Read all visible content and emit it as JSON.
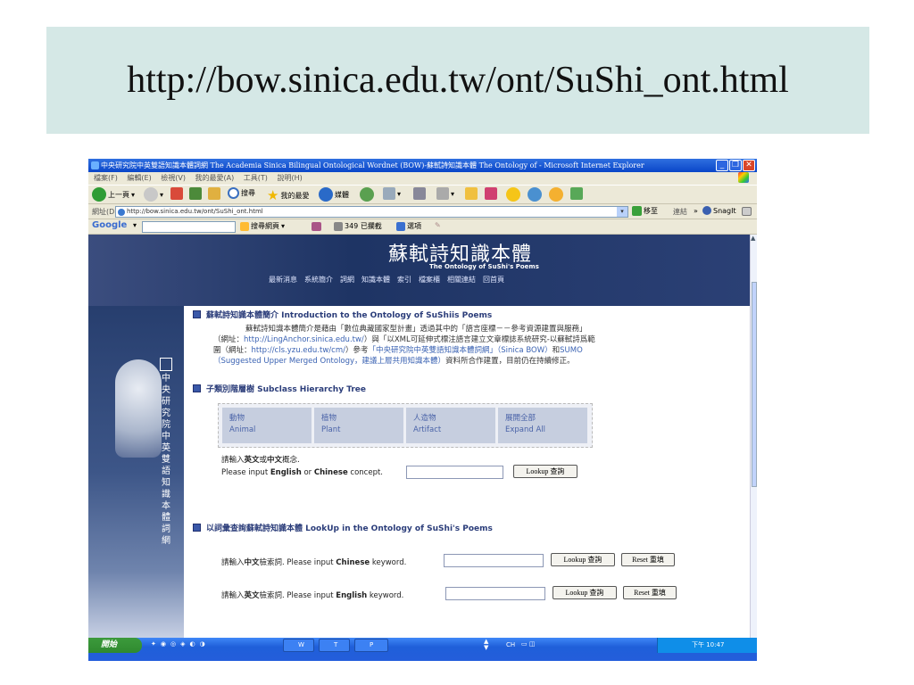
{
  "slide": {
    "title": "http://bow.sinica.edu.tw/ont/SuShi_ont.html"
  },
  "window": {
    "title": "中央研究院中英雙語知識本體詞網 The Academia Sinica Bilingual Ontological Wordnet (BOW)-蘇軾詩知識本體 The Ontology of - Microsoft Internet Explorer",
    "menu": [
      "檔案(F)",
      "編輯(E)",
      "檢視(V)",
      "我的最愛(A)",
      "工具(T)",
      "說明(H)"
    ],
    "toolbar": {
      "back": "上一頁",
      "search": "搜尋",
      "favorites": "我的最愛",
      "media": "媒體"
    },
    "address_label": "網址(D)",
    "address": "http://bow.sinica.edu.tw/ont/SuShi_ont.html",
    "go": "移至",
    "links": "連結",
    "snagit": "SnagIt",
    "google": {
      "logo": "Google",
      "search_web": "搜尋網頁",
      "blocked": "349 已攔截",
      "options": "選項"
    }
  },
  "page": {
    "banner_title": "蘇軾詩知識本體",
    "banner_subtitle": "The Ontology of SuShi's Poems",
    "nav": "最新消息　系統簡介　詞網　知識本體　索引　檔案櫃　相關連結　回首頁",
    "side_text": [
      "中",
      "央",
      "研",
      "究",
      "院",
      "中",
      "英",
      "雙",
      "語",
      "知",
      "識",
      "本",
      "體",
      "詞",
      "網"
    ],
    "intro": {
      "heading": "蘇軾詩知識本體簡介 Introduction to the Ontology of SuShiis Poems",
      "p1": "蘇軾詩知識本體簡介是藉由「數位典藏國家型計畫」透過其中的「語言座標－－參考資源建置與服務」",
      "p2_a": "（網址：",
      "p2_link1": "http://LingAnchor.sinica.edu.tw/",
      "p2_b": "）與「以XML可延伸式標注語言建立文章標誌系統研究-以蘇軾詩爲範",
      "p3_a": "圍（網址：",
      "p3_link": "http://cls.yzu.edu.tw/cm/",
      "p3_b": "）參考",
      "p3_link2": "「中央研究院中英雙語知識本體詞網」（Sinica BOW）",
      "p3_c": "和",
      "p3_link3": "SUMO",
      "p4_link": "（Suggested Upper Merged Ontology，建議上層共用知識本體）",
      "p4_b": "資料所合作建置，目前仍在持續修正。"
    },
    "subclass": {
      "heading": "子類別階層樹 Subclass Hierarchy Tree",
      "items": [
        {
          "zh": "動物",
          "en": "Animal"
        },
        {
          "zh": "植物",
          "en": "Plant"
        },
        {
          "zh": "人造物",
          "en": "Artifact"
        },
        {
          "zh": "展開全部",
          "en": "Expand All"
        }
      ],
      "prompt_zh_a": "請輸入",
      "prompt_zh_b": "英文",
      "prompt_zh_c": "或",
      "prompt_zh_d": "中文",
      "prompt_zh_e": "概念.",
      "prompt_en_a": "Please input ",
      "prompt_en_b": "English",
      "prompt_en_c": " or ",
      "prompt_en_d": "Chinese",
      "prompt_en_e": " concept.",
      "lookup_btn": "Lookup 查詢"
    },
    "lookup": {
      "heading": "以詞彙查詢蘇軾詩知識本體 LookUp in the Ontology of SuShi's Poems",
      "row1_a": "請輸入",
      "row1_b": "中文",
      "row1_c": "檢索詞. Please input ",
      "row1_d": "Chinese",
      "row1_e": " keyword.",
      "row2_a": "請輸入",
      "row2_b": "英文",
      "row2_c": "檢索詞. Please input ",
      "row2_d": "English",
      "row2_e": " keyword.",
      "lookup_btn": "Lookup 查詢",
      "reset_btn": "Reset 重填"
    }
  },
  "taskbar": {
    "start": "開始",
    "tasks": [
      "W",
      "T",
      "P"
    ],
    "lang": "CH",
    "clock": "下午 10:47"
  },
  "colors": {
    "slide_band": "#d5e8e6",
    "banner": "#1e3464",
    "accent_link": "#3b63b3"
  }
}
